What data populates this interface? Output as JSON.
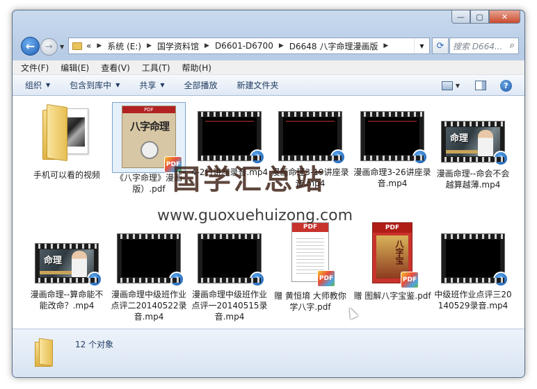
{
  "window": {
    "caption_buttons": {
      "minimize": "—",
      "maximize": "▢",
      "close": "✕"
    }
  },
  "nav": {
    "back_glyph": "←",
    "forward_glyph": "→",
    "crumb_overflow": "«",
    "crumbs": [
      "系统 (E:)",
      "国学资料馆",
      "D6601-D6700",
      "D6648 八字命理漫画版"
    ],
    "search_placeholder": "搜索 D664..."
  },
  "menubar": [
    "文件(F)",
    "编辑(E)",
    "查看(V)",
    "工具(T)",
    "帮助(H)"
  ],
  "toolbar": {
    "organize": "组织",
    "include_library": "包含到库中",
    "share": "共享",
    "play_all": "全部播放",
    "new_folder": "新建文件夹",
    "help": "?"
  },
  "files": [
    {
      "name": "手机可以看的视频",
      "kind": "folder",
      "icon": "folder-icon"
    },
    {
      "name": "《八字命理》漫画版）.pdf",
      "kind": "pdf-book",
      "icon": "pdf-icon",
      "selected": true,
      "cover_tag": "PDF",
      "cover_title": "八字命理"
    },
    {
      "name": "4-2日讲座录音.mp4",
      "kind": "video-black",
      "icon": "video-icon"
    },
    {
      "name": "漫画命理3-19讲座录音.mp4",
      "kind": "video-black",
      "icon": "video-icon"
    },
    {
      "name": "漫画命理3-26讲座录音.mp4",
      "kind": "video-black",
      "icon": "video-icon"
    },
    {
      "name": "漫画命理--命会不会越算越薄.mp4",
      "kind": "video-photo",
      "icon": "video-icon",
      "thumb_text": "命理"
    },
    {
      "name": "漫画命理--算命能不能改命？.mp4",
      "kind": "video-photo",
      "icon": "video-icon",
      "thumb_text": "命理"
    },
    {
      "name": "漫画命理中级班作业点评二20140522录音.mp4",
      "kind": "video-black",
      "icon": "video-icon"
    },
    {
      "name": "漫画命理中级班作业点评一20140515录音.mp4",
      "kind": "video-black",
      "icon": "video-icon"
    },
    {
      "name": "赠 黄恒堉 大师教你学八字.pdf",
      "kind": "pdf-doc",
      "icon": "pdf-icon",
      "cover_tag": "PDF"
    },
    {
      "name": "赠 图解八字宝鉴.pdf",
      "kind": "pdf-cover",
      "icon": "pdf-icon",
      "cover_tag": "PDF",
      "cover_title": "八字宝"
    },
    {
      "name": "中级班作业点评三20140529录音.mp4",
      "kind": "video-black",
      "icon": "video-icon"
    }
  ],
  "badges": {
    "pdf": "PDF",
    "media": "♪"
  },
  "watermark": {
    "cn": "国学汇总站",
    "url": "www.guoxuehuizong.com"
  },
  "status": {
    "count": "12 个对象"
  }
}
